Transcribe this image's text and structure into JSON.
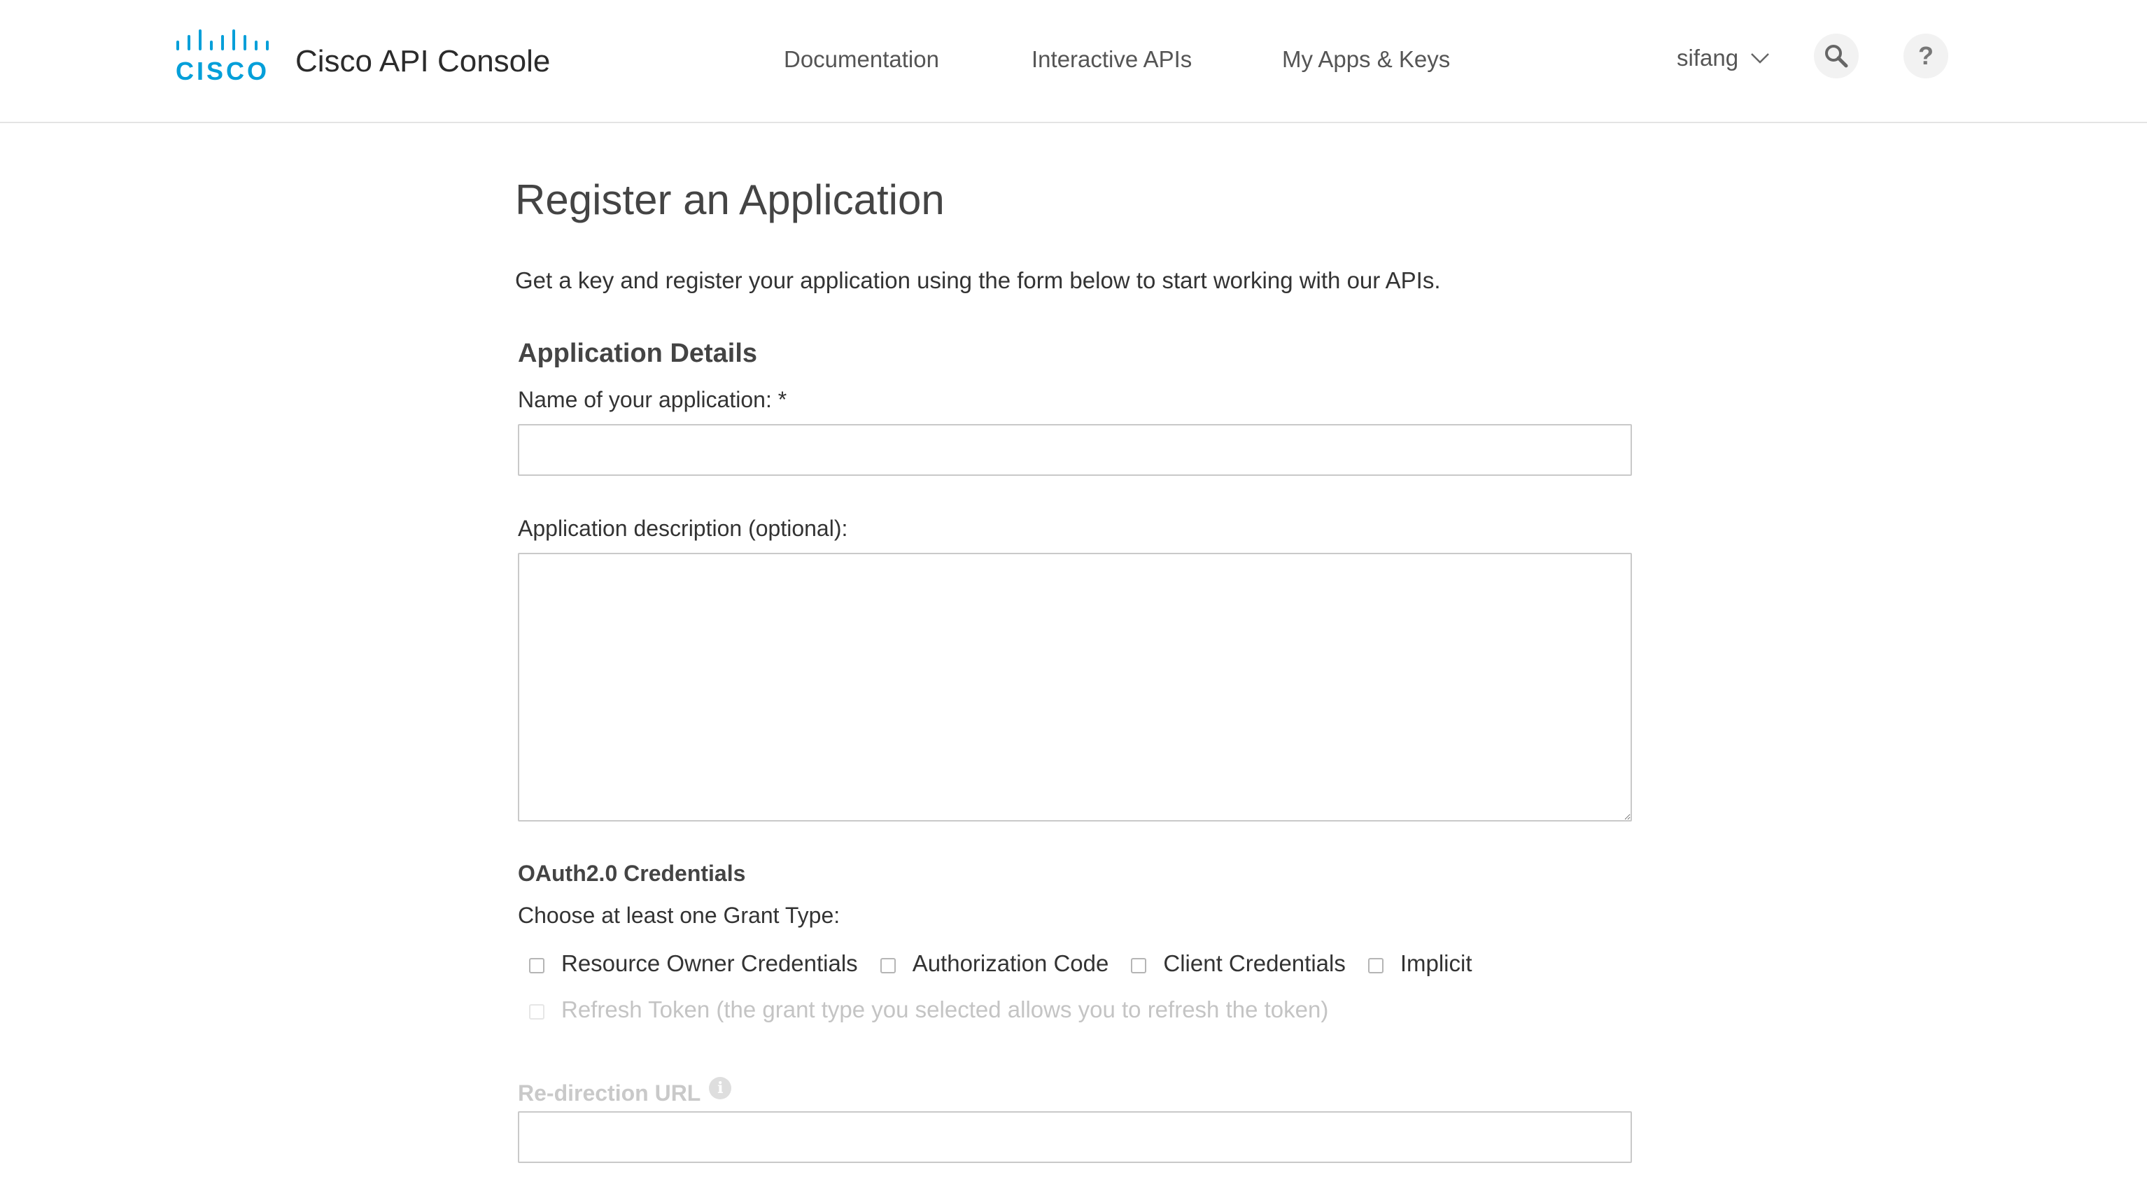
{
  "header": {
    "brand": "Cisco API Console",
    "logo_text": "CISCO",
    "nav": {
      "documentation": "Documentation",
      "interactive_apis": "Interactive APIs",
      "my_apps_keys": "My Apps & Keys"
    },
    "user": "sifang",
    "help_label": "?"
  },
  "page": {
    "title": "Register an Application",
    "intro": "Get a key and register your application using the form below to start working with our APIs."
  },
  "form": {
    "section_title": "Application Details",
    "name_label": "Name of your application: *",
    "name_value": "",
    "description_label": "Application description (optional):",
    "description_value": "",
    "oauth_title": "OAuth2.0 Credentials",
    "grant_label": "Choose at least one Grant Type:",
    "grant_types": [
      "Resource Owner Credentials",
      "Authorization Code",
      "Client Credentials",
      "Implicit"
    ],
    "refresh_token_label": "Refresh Token (the grant type you selected allows you to refresh the token)",
    "redirect_label": "Re-direction URL",
    "redirect_value": ""
  },
  "colors": {
    "cisco_blue": "#049fd9",
    "disabled_text": "#c4c4c4",
    "border": "#c9c9c9"
  },
  "icons": {
    "search": "search-icon",
    "help": "help-icon",
    "chevron": "chevron-down-icon",
    "info": "info-icon"
  }
}
